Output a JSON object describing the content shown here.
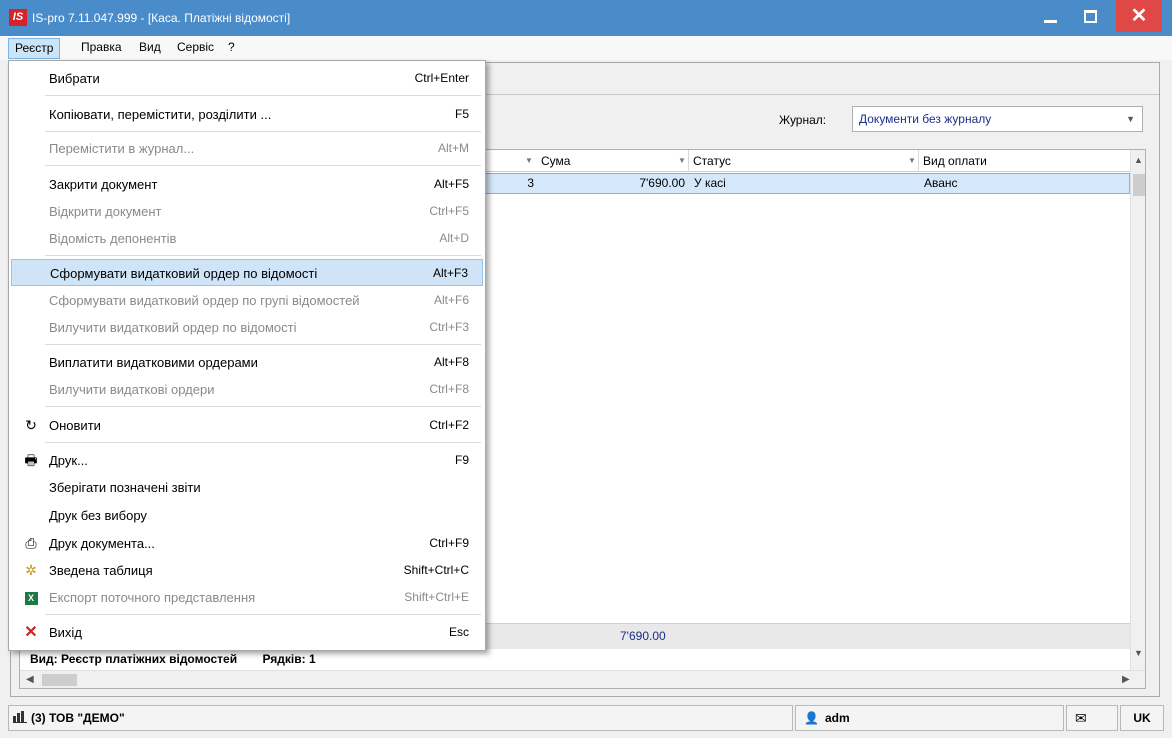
{
  "window": {
    "logo": "IS",
    "title": "IS-pro 7.11.047.999 - [Каса. Платіжні відомості]",
    "controls": {
      "minimize": "_",
      "maximize": "□",
      "close": "✕"
    }
  },
  "menubar": {
    "items": [
      "Реєстр",
      "Правка",
      "Вид",
      "Сервіс",
      "?"
    ],
    "active": "Реєстр"
  },
  "journal": {
    "label": "Журнал:",
    "value": "Документи без журналу"
  },
  "grid": {
    "columns": [
      "Сума",
      "Статус",
      "Вид оплати"
    ],
    "rows": [
      {
        "num": "3",
        "sum": "7'690.00",
        "status": "У касі",
        "payment_type": "Аванс"
      }
    ],
    "total": "7'690.00",
    "summary_view": "Вид: Реєстр платіжних відомостей",
    "summary_rows": "Рядків: 1"
  },
  "dropdown": {
    "items": [
      {
        "label": "Вибрати",
        "shortcut": "Ctrl+Enter",
        "disabled": false
      },
      {
        "label": "Копіювати, перемістити, розділити ...",
        "shortcut": "F5",
        "disabled": false
      },
      {
        "label": "Перемістити в журнал...",
        "shortcut": "Alt+M",
        "disabled": true
      },
      {
        "label": "Закрити документ",
        "shortcut": "Alt+F5",
        "disabled": false
      },
      {
        "label": "Відкрити документ",
        "shortcut": "Ctrl+F5",
        "disabled": true
      },
      {
        "label": "Відомість депонентів",
        "shortcut": "Alt+D",
        "disabled": true
      },
      {
        "label": "Сформувати видатковий ордер по відомості",
        "shortcut": "Alt+F3",
        "disabled": false,
        "highlighted": true
      },
      {
        "label": "Сформувати видатковий ордер по групі відомостей",
        "shortcut": "Alt+F6",
        "disabled": true
      },
      {
        "label": "Вилучити видатковий ордер по відомості",
        "shortcut": "Ctrl+F3",
        "disabled": true
      },
      {
        "label": "Виплатити видатковими ордерами",
        "shortcut": "Alt+F8",
        "disabled": false
      },
      {
        "label": "Вилучити видаткові ордери",
        "shortcut": "Ctrl+F8",
        "disabled": true
      },
      {
        "label": "Оновити",
        "shortcut": "Ctrl+F2",
        "disabled": false,
        "icon": "refresh-icon"
      },
      {
        "label": "Друк...",
        "shortcut": "F9",
        "disabled": false,
        "icon": "printer-icon"
      },
      {
        "label": "Зберігати позначені звіти",
        "shortcut": "",
        "disabled": false
      },
      {
        "label": "Друк без вибору",
        "shortcut": "",
        "disabled": false
      },
      {
        "label": "Друк документа...",
        "shortcut": "Ctrl+F9",
        "disabled": false,
        "icon": "print-document-icon"
      },
      {
        "label": "Зведена таблиця",
        "shortcut": "Shift+Ctrl+C",
        "disabled": false,
        "icon": "pivot-table-icon"
      },
      {
        "label": "Експорт поточного представлення",
        "shortcut": "Shift+Ctrl+E",
        "disabled": true,
        "icon": "excel-export-icon"
      },
      {
        "label": "Вихід",
        "shortcut": "Esc",
        "disabled": false,
        "icon": "exit-x-icon"
      }
    ]
  },
  "statusbar": {
    "org": "(3) ТОВ \"ДЕМО\"",
    "user": "adm",
    "lang": "UK"
  },
  "colors": {
    "titlebar": "#4a8cc9",
    "close_button": "#e04848",
    "highlight": "#cfe4f7",
    "selected_row": "#d5e8fb",
    "link_text": "#1a2f8a"
  }
}
